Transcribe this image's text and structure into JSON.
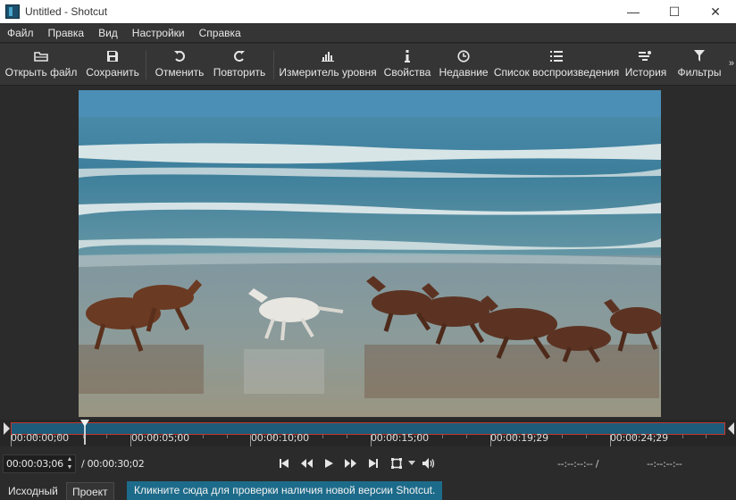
{
  "window": {
    "title": "Untitled - Shotcut",
    "minimize": "—",
    "maximize": "☐",
    "close": "✕"
  },
  "menu": [
    "Файл",
    "Правка",
    "Вид",
    "Настройки",
    "Справка"
  ],
  "toolbar": {
    "open": "Открыть файл",
    "save": "Сохранить",
    "undo": "Отменить",
    "redo": "Повторить",
    "meter": "Измеритель уровня",
    "properties": "Свойства",
    "recent": "Недавние",
    "playlist": "Список воспроизведения",
    "history": "История",
    "filters": "Фильтры",
    "more": "»"
  },
  "ruler": {
    "labels": [
      "00:00:00;00",
      "00:00:05;00",
      "00:00:10;00",
      "00:00:15;00",
      "00:00:19;29",
      "00:00:24;29"
    ]
  },
  "transport": {
    "current_timecode": "00:00:03;06",
    "total_duration": "/ 00:00:30;02",
    "in_point": "--:--:--:-- /",
    "out_point": "--:--:--:--",
    "playhead_fraction": 0.104
  },
  "tabs": {
    "source": "Исходный",
    "project": "Проект"
  },
  "notice": "Кликните сюда для проверки наличия новой версии Shotcut.",
  "colors": {
    "accent": "#1d6b8a",
    "scrub_bar": "#1e5a7a",
    "scrub_border": "#c0392b",
    "background": "#2b2b2b"
  }
}
